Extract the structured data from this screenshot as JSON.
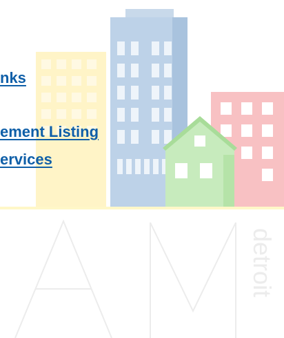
{
  "links": [
    {
      "label": "nks"
    },
    {
      "label": "ement Listing"
    },
    {
      "label": "ervices"
    }
  ],
  "watermark": {
    "big_letters": "A M",
    "vertical_text": "detroit"
  },
  "colors": {
    "link": "#0f5fa8",
    "tower_blue": "#b9cfe6",
    "house_green": "#bfe6b3",
    "building_red": "#f6b3b6",
    "building_yellow": "#fff0b0",
    "watermark": "#e8e8e8"
  }
}
